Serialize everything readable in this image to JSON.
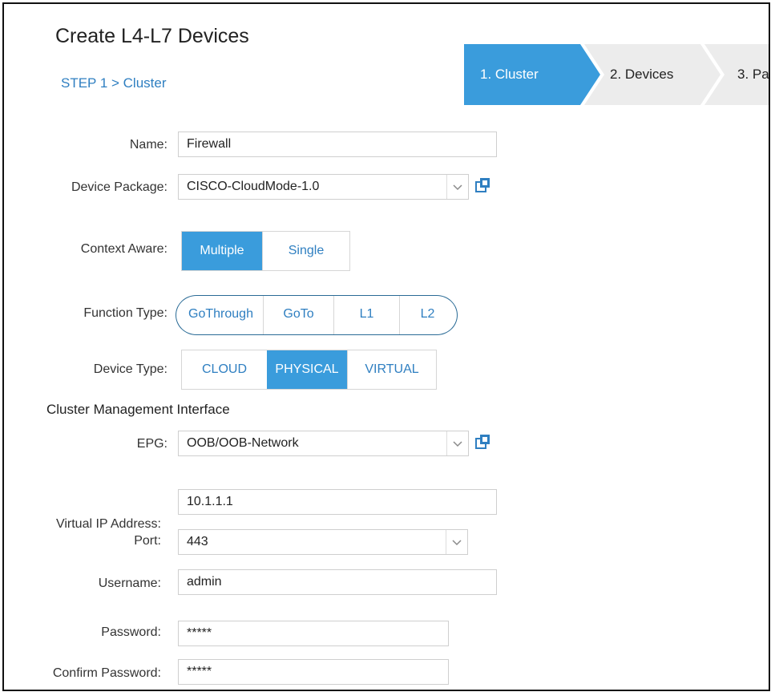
{
  "header": {
    "title": "Create L4-L7 Devices",
    "breadcrumb": "STEP 1 > Cluster"
  },
  "wizard": {
    "steps": [
      {
        "label": "1. Cluster",
        "active": true
      },
      {
        "label": "2. Devices",
        "active": false
      },
      {
        "label": "3. Pa",
        "active": false
      }
    ]
  },
  "form": {
    "name": {
      "label": "Name:",
      "value": "Firewall"
    },
    "device_package": {
      "label": "Device Package:",
      "value": "CISCO-CloudMode-1.0"
    },
    "context_aware": {
      "label": "Context Aware:",
      "options": [
        "Multiple",
        "Single"
      ],
      "selected": "Multiple"
    },
    "function_type": {
      "label": "Function Type:",
      "options": [
        "GoThrough",
        "GoTo",
        "L1",
        "L2"
      ]
    },
    "device_type": {
      "label": "Device Type:",
      "options": [
        "CLOUD",
        "PHYSICAL",
        "VIRTUAL"
      ],
      "selected": "PHYSICAL"
    },
    "cluster_mgmt": {
      "heading": "Cluster Management Interface"
    },
    "epg": {
      "label": "EPG:",
      "value": "OOB/OOB-Network"
    },
    "virtual_ip": {
      "label": "Virtual IP Address:",
      "value": "10.1.1.1"
    },
    "port": {
      "label": "Port:",
      "value": "443"
    },
    "username": {
      "label": "Username:",
      "value": "admin"
    },
    "password": {
      "label": "Password:",
      "value": "*****"
    },
    "confirm_password": {
      "label": "Confirm Password:",
      "value": "*****"
    }
  },
  "colors": {
    "accent": "#3a9cdc",
    "link": "#2f7fc1",
    "inactive_step": "#ececec"
  },
  "icons": {
    "dropdown": "chevron-down-icon",
    "external": "open-external-icon"
  }
}
